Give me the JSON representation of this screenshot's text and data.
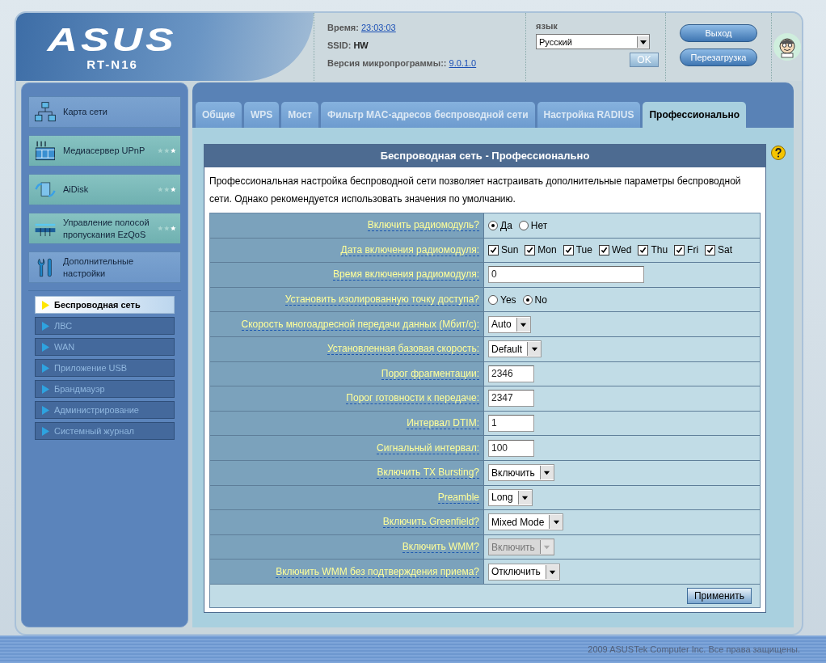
{
  "header": {
    "logo": "ASUS",
    "model": "RT-N16",
    "time_label": "Время:",
    "time": "23:03:03",
    "ssid_label": "SSID:",
    "ssid": "HW",
    "firmware_label": "Версия микропрограммы::",
    "firmware": "9.0.1.0",
    "language_label": "язык",
    "language": "Русский",
    "ok_button": "OK",
    "logout_button": "Выход",
    "reboot_button": "Перезагрузка"
  },
  "sidebar": {
    "items": [
      {
        "kind": "network-map",
        "label": "Карта сети",
        "featured": false
      },
      {
        "kind": "media",
        "label": "Медиасервер UPnP",
        "featured": true
      },
      {
        "kind": "disk",
        "label": "AiDisk",
        "featured": true
      },
      {
        "kind": "qos",
        "label": "Управление полосой пропускания EzQoS",
        "featured": true
      },
      {
        "kind": "tools",
        "label": "Дополнительные настройки",
        "featured": false
      }
    ],
    "submenu": [
      {
        "label": "Беспроводная сеть",
        "selected": true
      },
      {
        "label": "ЛВС",
        "selected": false
      },
      {
        "label": "WAN",
        "selected": false
      },
      {
        "label": "Приложение USB",
        "selected": false
      },
      {
        "label": "Брандмауэр",
        "selected": false
      },
      {
        "label": "Администрирование",
        "selected": false
      },
      {
        "label": "Системный журнал",
        "selected": false
      }
    ]
  },
  "tabs": [
    {
      "label": "Общие",
      "selected": false
    },
    {
      "label": "WPS",
      "selected": false
    },
    {
      "label": "Мост",
      "selected": false
    },
    {
      "label": "Фильтр MAC-адресов беспроводной сети",
      "selected": false
    },
    {
      "label": "Настройка RADIUS",
      "selected": false
    },
    {
      "label": "Профессионально",
      "selected": true
    }
  ],
  "panel": {
    "title": "Беспроводная сеть - Профессионально",
    "description": "Профессиональная настройка беспроводной сети позволяет настраивать дополнительные параметры беспроводной сети. Однако рекомендуется использовать значения по умолчанию.",
    "fields": [
      {
        "kind": "radio",
        "label": "Включить радиомодуль?",
        "options": [
          {
            "label": "Да",
            "selected": true
          },
          {
            "label": "Нет",
            "selected": false
          }
        ]
      },
      {
        "kind": "checkboxes",
        "label": "Дата включения радиомодуля:",
        "options": [
          {
            "label": "Sun",
            "checked": true
          },
          {
            "label": "Mon",
            "checked": true
          },
          {
            "label": "Tue",
            "checked": true
          },
          {
            "label": "Wed",
            "checked": true
          },
          {
            "label": "Thu",
            "checked": true
          },
          {
            "label": "Fri",
            "checked": true
          },
          {
            "label": "Sat",
            "checked": true
          }
        ]
      },
      {
        "kind": "timerange",
        "label": "Время включения радиомодуля:",
        "value": "0"
      },
      {
        "kind": "radio",
        "label": "Установить изолированную точку доступа?",
        "options": [
          {
            "label": "Yes",
            "selected": false
          },
          {
            "label": "No",
            "selected": true
          }
        ]
      },
      {
        "kind": "select",
        "label": "Скорость многоадресной передачи данных (Мбит/с):",
        "value": "Auto",
        "disabled": false
      },
      {
        "kind": "select",
        "label": "Установленная базовая скорость:",
        "value": "Default",
        "disabled": false
      },
      {
        "kind": "text",
        "label": "Порог фрагментации:",
        "value": "2346"
      },
      {
        "kind": "text",
        "label": "Порог готовности к передаче:",
        "value": "2347"
      },
      {
        "kind": "text",
        "label": "Интервал DTIM:",
        "value": "1"
      },
      {
        "kind": "text",
        "label": "Сигнальный интервал:",
        "value": "100"
      },
      {
        "kind": "select",
        "label": "Включить TX Bursting?",
        "value": "Включить",
        "disabled": false
      },
      {
        "kind": "select",
        "label": "Preamble",
        "value": "Long",
        "disabled": false
      },
      {
        "kind": "select",
        "label": "Включить Greenfield?",
        "value": "Mixed Mode",
        "disabled": false
      },
      {
        "kind": "select",
        "label": "Включить WMM?",
        "value": "Включить",
        "disabled": true
      },
      {
        "kind": "select",
        "label": "Включить WMM без подтверждения приема?",
        "value": "Отключить",
        "disabled": false
      }
    ],
    "apply_button": "Применить"
  },
  "footer": "2009 ASUSTek Computer Inc. Все права защищены."
}
